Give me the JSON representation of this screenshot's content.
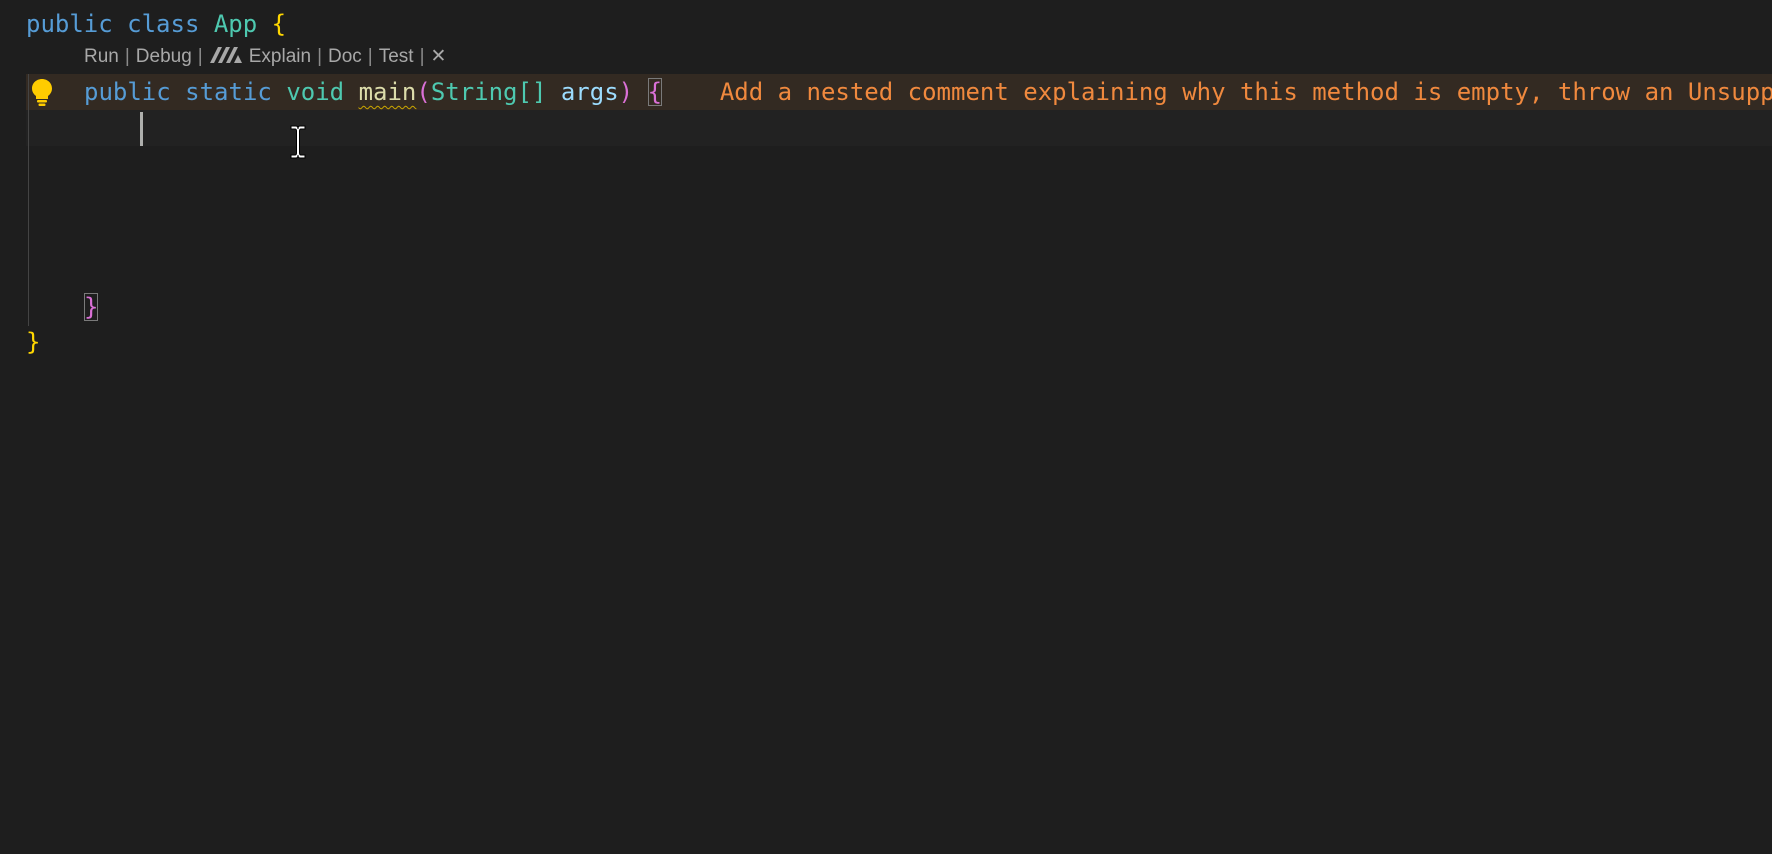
{
  "codelens": {
    "run": "Run",
    "debug": "Debug",
    "explain": "Explain",
    "doc": "Doc",
    "test": "Test",
    "separator": "|",
    "close_glyph": "✕"
  },
  "code": {
    "line1": {
      "kw_public": "public",
      "kw_class": "class",
      "class_name": "App",
      "open_brace": "{"
    },
    "line2": {
      "kw_public": "public",
      "kw_static": "static",
      "kw_void": "void",
      "method_name": "main",
      "open_paren": "(",
      "param_type": "String[]",
      "param_name": "args",
      "close_paren": ")",
      "open_brace": "{",
      "ghost_text": "Add a nested comment explaining why this method is empty, throw an Unsupp"
    },
    "line7": {
      "close_brace": "}"
    },
    "line8": {
      "close_brace": "}"
    }
  },
  "icons": {
    "lightbulb": "lightbulb-icon",
    "ai_logo": "ai-assistant-logo-icon",
    "close": "close-icon",
    "cursor": "ibeam-cursor-icon"
  },
  "colors": {
    "background": "#1e1e1e",
    "keyword": "#569cd6",
    "type": "#4ec9b0",
    "function": "#dcdcaa",
    "parameter": "#9cdcfe",
    "brace_outer": "#ffd700",
    "brace_inner": "#da70d6",
    "ghost_text": "#f0893e",
    "lightbulb": "#ffcc00"
  }
}
